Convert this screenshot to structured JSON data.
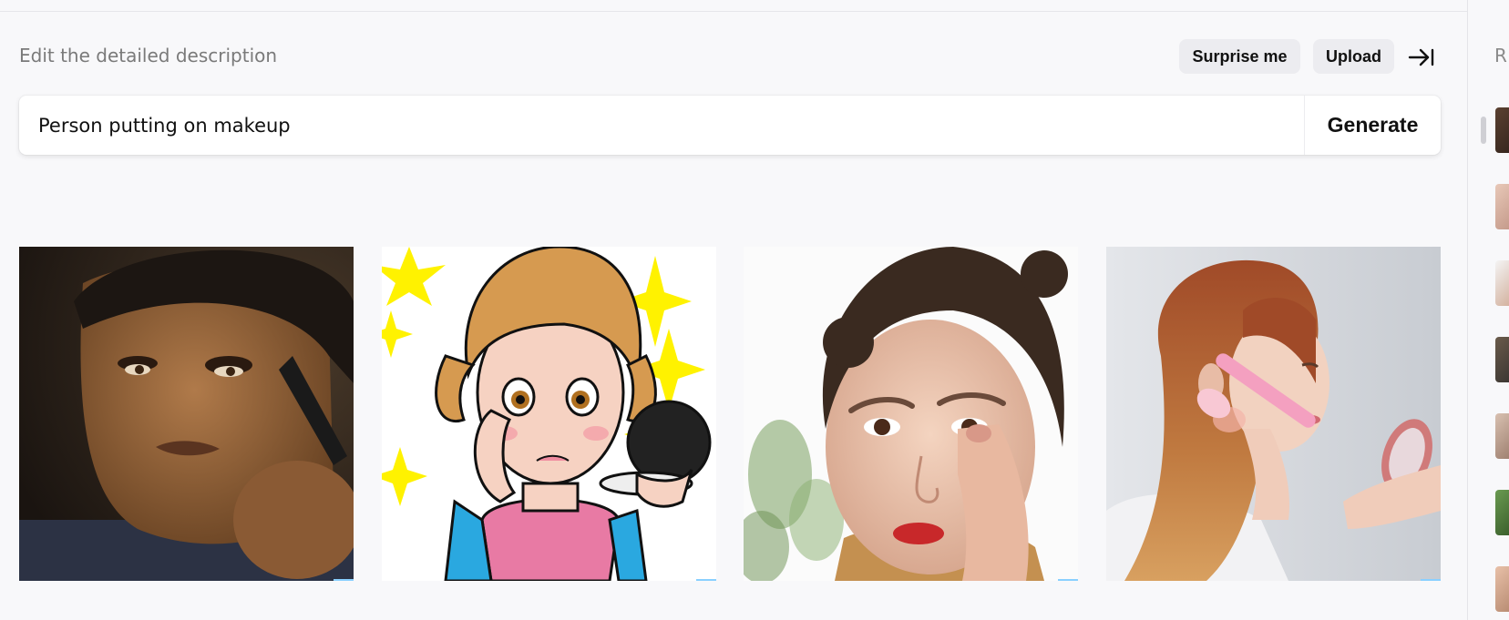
{
  "header": {
    "label": "Edit the detailed description",
    "surprise_label": "Surprise me",
    "upload_label": "Upload",
    "collapse_icon": "arrow-right-to-line-icon"
  },
  "prompt": {
    "value": "Person putting on makeup",
    "generate_label": "Generate"
  },
  "results": [
    {
      "style": "photo",
      "subject": "man applying makeup brush"
    },
    {
      "style": "cartoon",
      "subject": "anime woman holding compact mirror"
    },
    {
      "style": "photo",
      "subject": "woman touching under eye"
    },
    {
      "style": "photo",
      "subject": "woman with pink brush and mirror"
    }
  ],
  "recents": {
    "label": "R",
    "count": 7
  }
}
